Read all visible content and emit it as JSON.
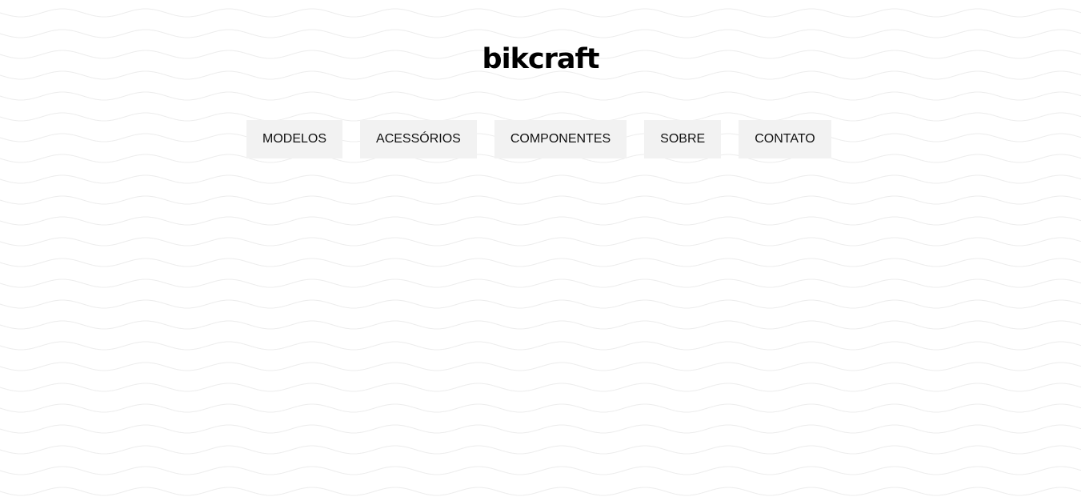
{
  "brand": {
    "name": "bikcraft"
  },
  "nav": {
    "items": [
      {
        "label": "MODELOS"
      },
      {
        "label": "ACESSÓRIOS"
      },
      {
        "label": "COMPONENTES"
      },
      {
        "label": "SOBRE"
      },
      {
        "label": "CONTATO"
      }
    ]
  },
  "colors": {
    "background": "#ffffff",
    "pattern": "#ececec",
    "nav_background": "#f2f2f2",
    "text": "#000000"
  }
}
